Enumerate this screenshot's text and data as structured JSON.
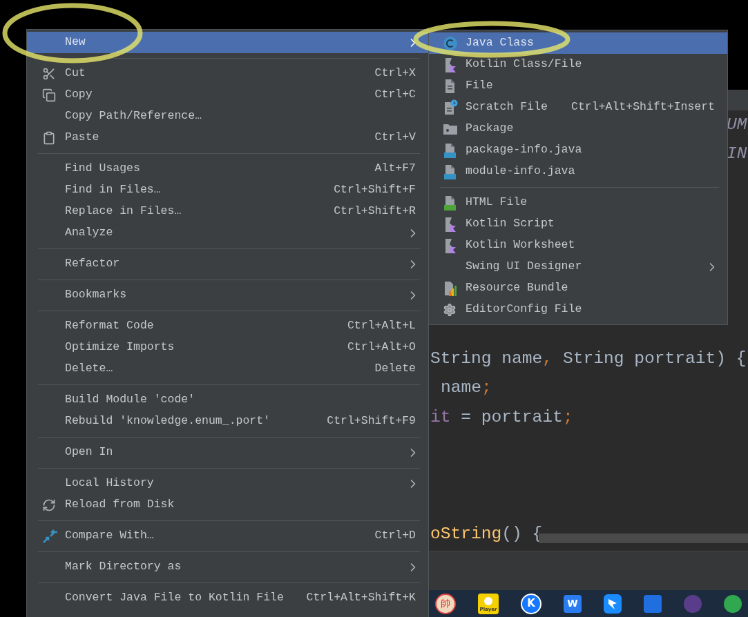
{
  "main_menu": {
    "groups": [
      {
        "items": [
          {
            "label": "New",
            "has_submenu": true,
            "selected": true
          }
        ]
      },
      {
        "items": [
          {
            "label": "Cut",
            "shortcut": "Ctrl+X",
            "has_submenu": false,
            "selected": false
          },
          {
            "label": "Copy",
            "shortcut": "Ctrl+C",
            "has_submenu": false,
            "selected": false
          },
          {
            "label": "Copy Path/Reference…",
            "has_submenu": false,
            "selected": false
          },
          {
            "label": "Paste",
            "shortcut": "Ctrl+V",
            "has_submenu": false,
            "selected": false
          }
        ]
      },
      {
        "items": [
          {
            "label": "Find Usages",
            "shortcut": "Alt+F7",
            "has_submenu": false,
            "selected": false
          },
          {
            "label": "Find in Files…",
            "shortcut": "Ctrl+Shift+F",
            "has_submenu": false,
            "selected": false
          },
          {
            "label": "Replace in Files…",
            "shortcut": "Ctrl+Shift+R",
            "has_submenu": false,
            "selected": false
          },
          {
            "label": "Analyze",
            "has_submenu": true,
            "selected": false
          }
        ]
      },
      {
        "items": [
          {
            "label": "Refactor",
            "has_submenu": true,
            "selected": false
          }
        ]
      },
      {
        "items": [
          {
            "label": "Bookmarks",
            "has_submenu": true,
            "selected": false
          }
        ]
      },
      {
        "items": [
          {
            "label": "Reformat Code",
            "shortcut": "Ctrl+Alt+L",
            "has_submenu": false,
            "selected": false
          },
          {
            "label": "Optimize Imports",
            "shortcut": "Ctrl+Alt+O",
            "has_submenu": false,
            "selected": false
          },
          {
            "label": "Delete…",
            "shortcut": "Delete",
            "has_submenu": false,
            "selected": false
          }
        ]
      },
      {
        "items": [
          {
            "label": "Build Module 'code'",
            "has_submenu": false,
            "selected": false
          },
          {
            "label": "Rebuild 'knowledge.enum_.port'",
            "shortcut": "Ctrl+Shift+F9",
            "has_submenu": false,
            "selected": false
          }
        ]
      },
      {
        "items": [
          {
            "label": "Open In",
            "has_submenu": true,
            "selected": false
          }
        ]
      },
      {
        "items": [
          {
            "label": "Local History",
            "has_submenu": true,
            "selected": false
          },
          {
            "label": "Reload from Disk",
            "has_submenu": false,
            "selected": false
          }
        ]
      },
      {
        "items": [
          {
            "label": "Compare With…",
            "shortcut": "Ctrl+D",
            "has_submenu": false,
            "selected": false
          }
        ]
      },
      {
        "items": [
          {
            "label": "Mark Directory as",
            "has_submenu": true,
            "selected": false
          }
        ]
      },
      {
        "items": [
          {
            "label": "Convert Java File to Kotlin File",
            "shortcut": "Ctrl+Alt+Shift+K",
            "has_submenu": false,
            "selected": false
          }
        ]
      }
    ]
  },
  "new_submenu": {
    "groups": [
      {
        "items": [
          {
            "label": "Java Class",
            "has_submenu": false,
            "selected": true
          },
          {
            "label": "Kotlin Class/File",
            "has_submenu": false,
            "selected": false
          },
          {
            "label": "File",
            "has_submenu": false,
            "selected": false
          },
          {
            "label": "Scratch File",
            "shortcut": "Ctrl+Alt+Shift+Insert",
            "has_submenu": false,
            "selected": false
          },
          {
            "label": "Package",
            "has_submenu": false,
            "selected": false
          },
          {
            "label": "package-info.java",
            "has_submenu": false,
            "selected": false
          },
          {
            "label": "module-info.java",
            "has_submenu": false,
            "selected": false
          }
        ]
      },
      {
        "items": [
          {
            "label": "HTML File",
            "has_submenu": false,
            "selected": false
          },
          {
            "label": "Kotlin Script",
            "has_submenu": false,
            "selected": false
          },
          {
            "label": "Kotlin Worksheet",
            "has_submenu": false,
            "selected": false
          },
          {
            "label": "Swing UI Designer",
            "has_submenu": true,
            "selected": false
          },
          {
            "label": "Resource Bundle",
            "has_submenu": false,
            "selected": false
          },
          {
            "label": "EditorConfig File",
            "has_submenu": false,
            "selected": false
          }
        ]
      }
    ]
  },
  "editor": {
    "lines": [
      {
        "tokens": [
          {
            "text": "UM",
            "kind": "constant"
          }
        ]
      },
      {
        "tokens": [
          {
            "text": "IN",
            "kind": "constant"
          }
        ]
      },
      {
        "tokens": [
          {
            "text": "String name",
            "kind": "plain"
          },
          {
            "text": ",",
            "kind": "punct"
          },
          {
            "text": " String portrait) {",
            "kind": "plain"
          }
        ]
      },
      {
        "tokens": [
          {
            "text": "name",
            "kind": "plain"
          },
          {
            "text": ";",
            "kind": "punct"
          }
        ]
      },
      {
        "tokens": [
          {
            "text": "it",
            "kind": "field"
          },
          {
            "text": " = portrait",
            "kind": "plain"
          },
          {
            "text": ";",
            "kind": "punct"
          }
        ]
      },
      {
        "tokens": [
          {
            "text": "oString",
            "kind": "method"
          },
          {
            "text": "() {",
            "kind": "plain"
          }
        ]
      }
    ]
  },
  "taskbar": {
    "apps": [
      {
        "kind": "chess",
        "label": "帥"
      },
      {
        "kind": "player",
        "label": "Player"
      },
      {
        "kind": "circle",
        "label": "K"
      },
      {
        "kind": "square",
        "label": "W"
      },
      {
        "kind": "bird"
      },
      {
        "kind": "blue"
      },
      {
        "kind": "purple"
      },
      {
        "kind": "green"
      }
    ]
  }
}
